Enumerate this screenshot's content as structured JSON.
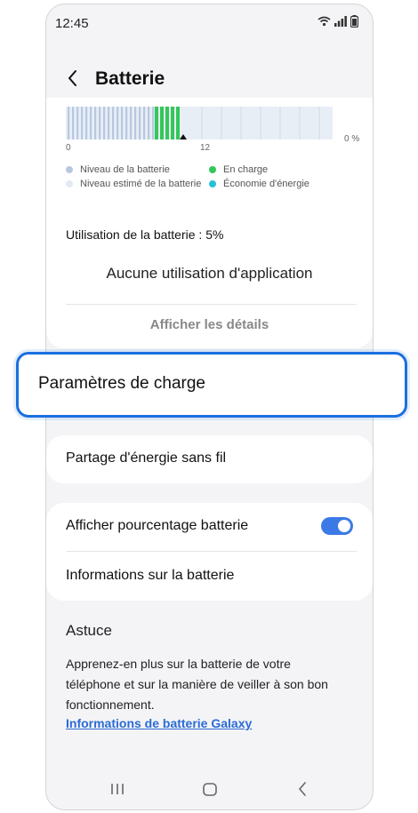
{
  "status_bar": {
    "time": "12:45"
  },
  "header": {
    "title": "Batterie"
  },
  "chart_data": {
    "type": "bar",
    "x_tick_labels": [
      "0",
      "12"
    ],
    "y_tick_label": "0 %",
    "legend": [
      {
        "label": "Niveau de la batterie",
        "color": "#b8c8e0"
      },
      {
        "label": "En charge",
        "color": "#34c759"
      },
      {
        "label": "Niveau estimé de la batterie",
        "color": "#e3e9f2"
      },
      {
        "label": "Économie d'énergie",
        "color": "#26c0d8"
      }
    ]
  },
  "usage": {
    "label": "Utilisation de la batterie : 5%",
    "no_app_usage": "Aucune utilisation d'application",
    "details_button": "Afficher les détails"
  },
  "charging_settings": {
    "label": "Paramètres de charge"
  },
  "wireless_share": {
    "label": "Partage d'énergie sans fil"
  },
  "display": {
    "percent_label": "Afficher pourcentage batterie",
    "percent_toggle_on": true,
    "info_label": "Informations sur la batterie"
  },
  "tip": {
    "title": "Astuce",
    "body": "Apprenez-en plus sur la batterie de votre téléphone et sur la manière de veiller à son bon fonctionnement.",
    "link": "Informations de batterie Galaxy"
  },
  "colors": {
    "accent": "#3b7ae6",
    "highlight_border": "#1a6fe0",
    "link": "#2a6bd6"
  },
  "navbar": {
    "icons": [
      "recent-apps-icon",
      "home-icon",
      "back-icon"
    ]
  }
}
